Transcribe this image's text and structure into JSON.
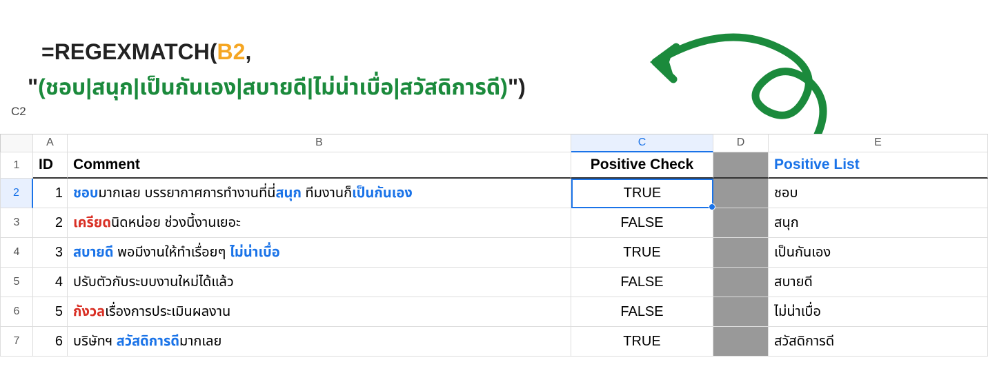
{
  "formula": {
    "func": "REGEXMATCH(",
    "cell_ref": "B2",
    "comma": " ,",
    "quote": "\"",
    "regex": "(ชอบ|สนุก|เป็นกันเอง|สบายดี|ไม่น่าเบื่อ|สวัสดิการดี)",
    "close_paren": ")"
  },
  "name_box": "C2",
  "columns": {
    "blank": "",
    "a": "A",
    "b": "B",
    "c": "C",
    "d": "D",
    "e": "E"
  },
  "headers": {
    "id": "ID",
    "comment": "Comment",
    "positive_check": "Positive Check",
    "positive_list": "Positive List"
  },
  "rows": [
    {
      "n": "2",
      "id": "1",
      "comment": [
        {
          "t": "ชอบ",
          "cls": "pos-word"
        },
        {
          "t": "มากเลย บรรยากาศการทำงานที่นี่",
          "cls": ""
        },
        {
          "t": "สนุก",
          "cls": "pos-word"
        },
        {
          "t": " ทีมงานก็",
          "cls": ""
        },
        {
          "t": "เป็นกันเอง",
          "cls": "pos-word"
        }
      ],
      "check": "TRUE",
      "list": "ชอบ",
      "active": true
    },
    {
      "n": "3",
      "id": "2",
      "comment": [
        {
          "t": "เครียด",
          "cls": "neg-word"
        },
        {
          "t": "นิดหน่อย ช่วงนี้งานเยอะ",
          "cls": ""
        }
      ],
      "check": "FALSE",
      "list": "สนุก"
    },
    {
      "n": "4",
      "id": "3",
      "comment": [
        {
          "t": "สบายดี",
          "cls": "pos-word"
        },
        {
          "t": " พอมีงานให้ทำเรื่อยๆ ",
          "cls": ""
        },
        {
          "t": "ไม่น่าเบื่อ",
          "cls": "pos-word"
        }
      ],
      "check": "TRUE",
      "list": "เป็นกันเอง"
    },
    {
      "n": "5",
      "id": "4",
      "comment": [
        {
          "t": "ปรับตัวกับระบบงานใหม่ได้แล้ว",
          "cls": ""
        }
      ],
      "check": "FALSE",
      "list": "สบายดี"
    },
    {
      "n": "6",
      "id": "5",
      "comment": [
        {
          "t": "กังวล",
          "cls": "neg-word"
        },
        {
          "t": "เรื่องการประเมินผลงาน",
          "cls": ""
        }
      ],
      "check": "FALSE",
      "list": "ไม่น่าเบื่อ"
    },
    {
      "n": "7",
      "id": "6",
      "comment": [
        {
          "t": "บริษัทฯ ",
          "cls": ""
        },
        {
          "t": "สวัสดิการดี",
          "cls": "pos-word"
        },
        {
          "t": "มากเลย",
          "cls": ""
        }
      ],
      "check": "TRUE",
      "list": "สวัสดิการดี"
    }
  ]
}
